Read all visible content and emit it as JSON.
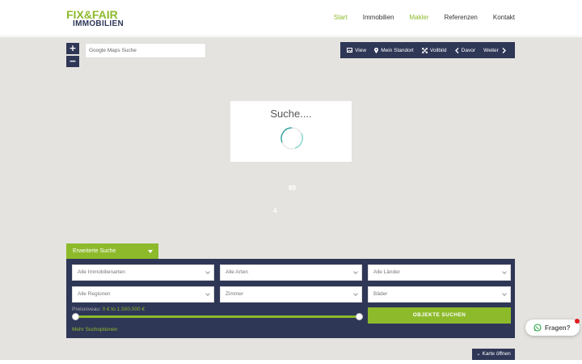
{
  "logo": {
    "line1": "FIX&FAIR",
    "line2": "IMMOBILIEN"
  },
  "nav": [
    {
      "label": "Start",
      "active": true
    },
    {
      "label": "Immobilien",
      "active": false
    },
    {
      "label": "Makler",
      "active": true
    },
    {
      "label": "Referenzen",
      "active": false
    },
    {
      "label": "Kontakt",
      "active": false
    }
  ],
  "map": {
    "zoom_in": "+",
    "zoom_out": "−",
    "search_placeholder": "Google Maps Suche",
    "tools": {
      "view": "View",
      "location": "Mein Standort",
      "fullscreen": "Vollbild",
      "prev": "Davor",
      "next": "Weiter"
    },
    "loading_text": "Suche....",
    "clusters": [
      "89",
      "4"
    ]
  },
  "search": {
    "tab_label": "Erweiterte Suche",
    "fields": {
      "types": "Alle Immobilienarten",
      "kinds": "Alle Arten",
      "countries": "Alle Länder",
      "regions": "Alle Regionen",
      "rooms": "Zimmer",
      "baths": "Bäder"
    },
    "price_label": "Preisniveau:",
    "price_value": "0 € to 1.500.000 €",
    "submit": "OBJEKTE SUCHEN",
    "more": "Mehr Suchoptionen"
  },
  "karte_button": "Karte öffnen",
  "chat": {
    "label": "Fragen?"
  },
  "colors": {
    "accent": "#8dba2b",
    "navy": "#2f3757",
    "map": "#e5e3df"
  }
}
